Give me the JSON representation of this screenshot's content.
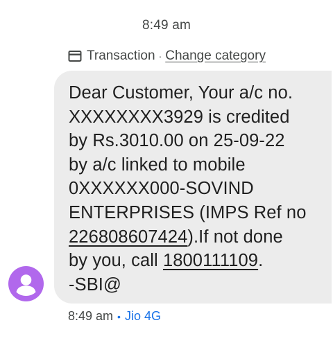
{
  "header": {
    "timestamp": "8:49 am"
  },
  "category": {
    "icon": "card-icon",
    "label": "Transaction",
    "separator": "·",
    "change_link": "Change category"
  },
  "message": {
    "segments": [
      {
        "text": "Dear Customer, Your a/c no.\nXXXXXXXX3929 is credited\nby Rs.3010.00 on 25-09-22\nby a/c linked to mobile\n0XXXXXX000-SOVIND\nENTERPRISES (IMPS Ref no\n",
        "link": false
      },
      {
        "text": "226808607424",
        "link": true
      },
      {
        "text": ").If not done\nby you, call ",
        "link": false
      },
      {
        "text": "1800111109",
        "link": true
      },
      {
        "text": ".\n-SBI@",
        "link": false
      }
    ]
  },
  "sender": {
    "avatar_icon": "person-icon",
    "avatar_color": "#b168ec"
  },
  "footer": {
    "time": "8:49 am",
    "separator": "•",
    "network": "Jio 4G",
    "network_color": "#1a73e8"
  }
}
